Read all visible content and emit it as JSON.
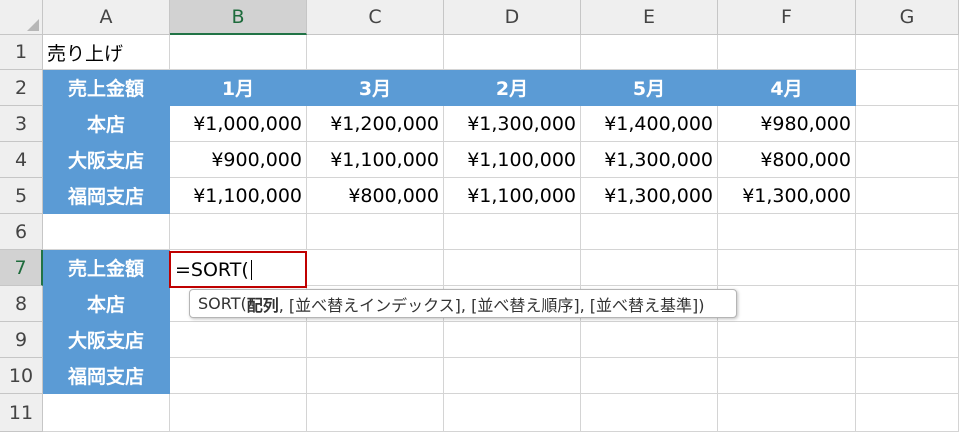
{
  "columns": [
    "A",
    "B",
    "C",
    "D",
    "E",
    "F",
    "G"
  ],
  "rows": [
    "1",
    "2",
    "3",
    "4",
    "5",
    "6",
    "7",
    "8",
    "9",
    "10",
    "11"
  ],
  "selected_column": "B",
  "selected_row": "7",
  "cells": {
    "a1": "売り上げ",
    "a2": "売上金額",
    "b2": "1月",
    "c2": "3月",
    "d2": "2月",
    "e2": "5月",
    "f2": "4月",
    "a3": "本店",
    "b3": "¥1,000,000",
    "c3": "¥1,200,000",
    "d3": "¥1,300,000",
    "e3": "¥1,400,000",
    "f3": "¥980,000",
    "a4": "大阪支店",
    "b4": "¥900,000",
    "c4": "¥1,100,000",
    "d4": "¥1,100,000",
    "e4": "¥1,300,000",
    "f4": "¥800,000",
    "a5": "福岡支店",
    "b5": "¥1,100,000",
    "c5": "¥800,000",
    "d5": "¥1,100,000",
    "e5": "¥1,300,000",
    "f5": "¥1,300,000",
    "a7": "売上金額",
    "a8": "本店",
    "a9": "大阪支店",
    "a10": "福岡支店"
  },
  "editing_cell": {
    "ref": "B7",
    "formula": "=SORT("
  },
  "tooltip": {
    "func": "SORT(",
    "arg1": "配列",
    "rest": ", [並べ替えインデックス], [並べ替え順序], [並べ替え基準])"
  },
  "colors": {
    "header_fill": "#5b9bd5",
    "edit_border": "#c00000",
    "selection": "#217346"
  }
}
